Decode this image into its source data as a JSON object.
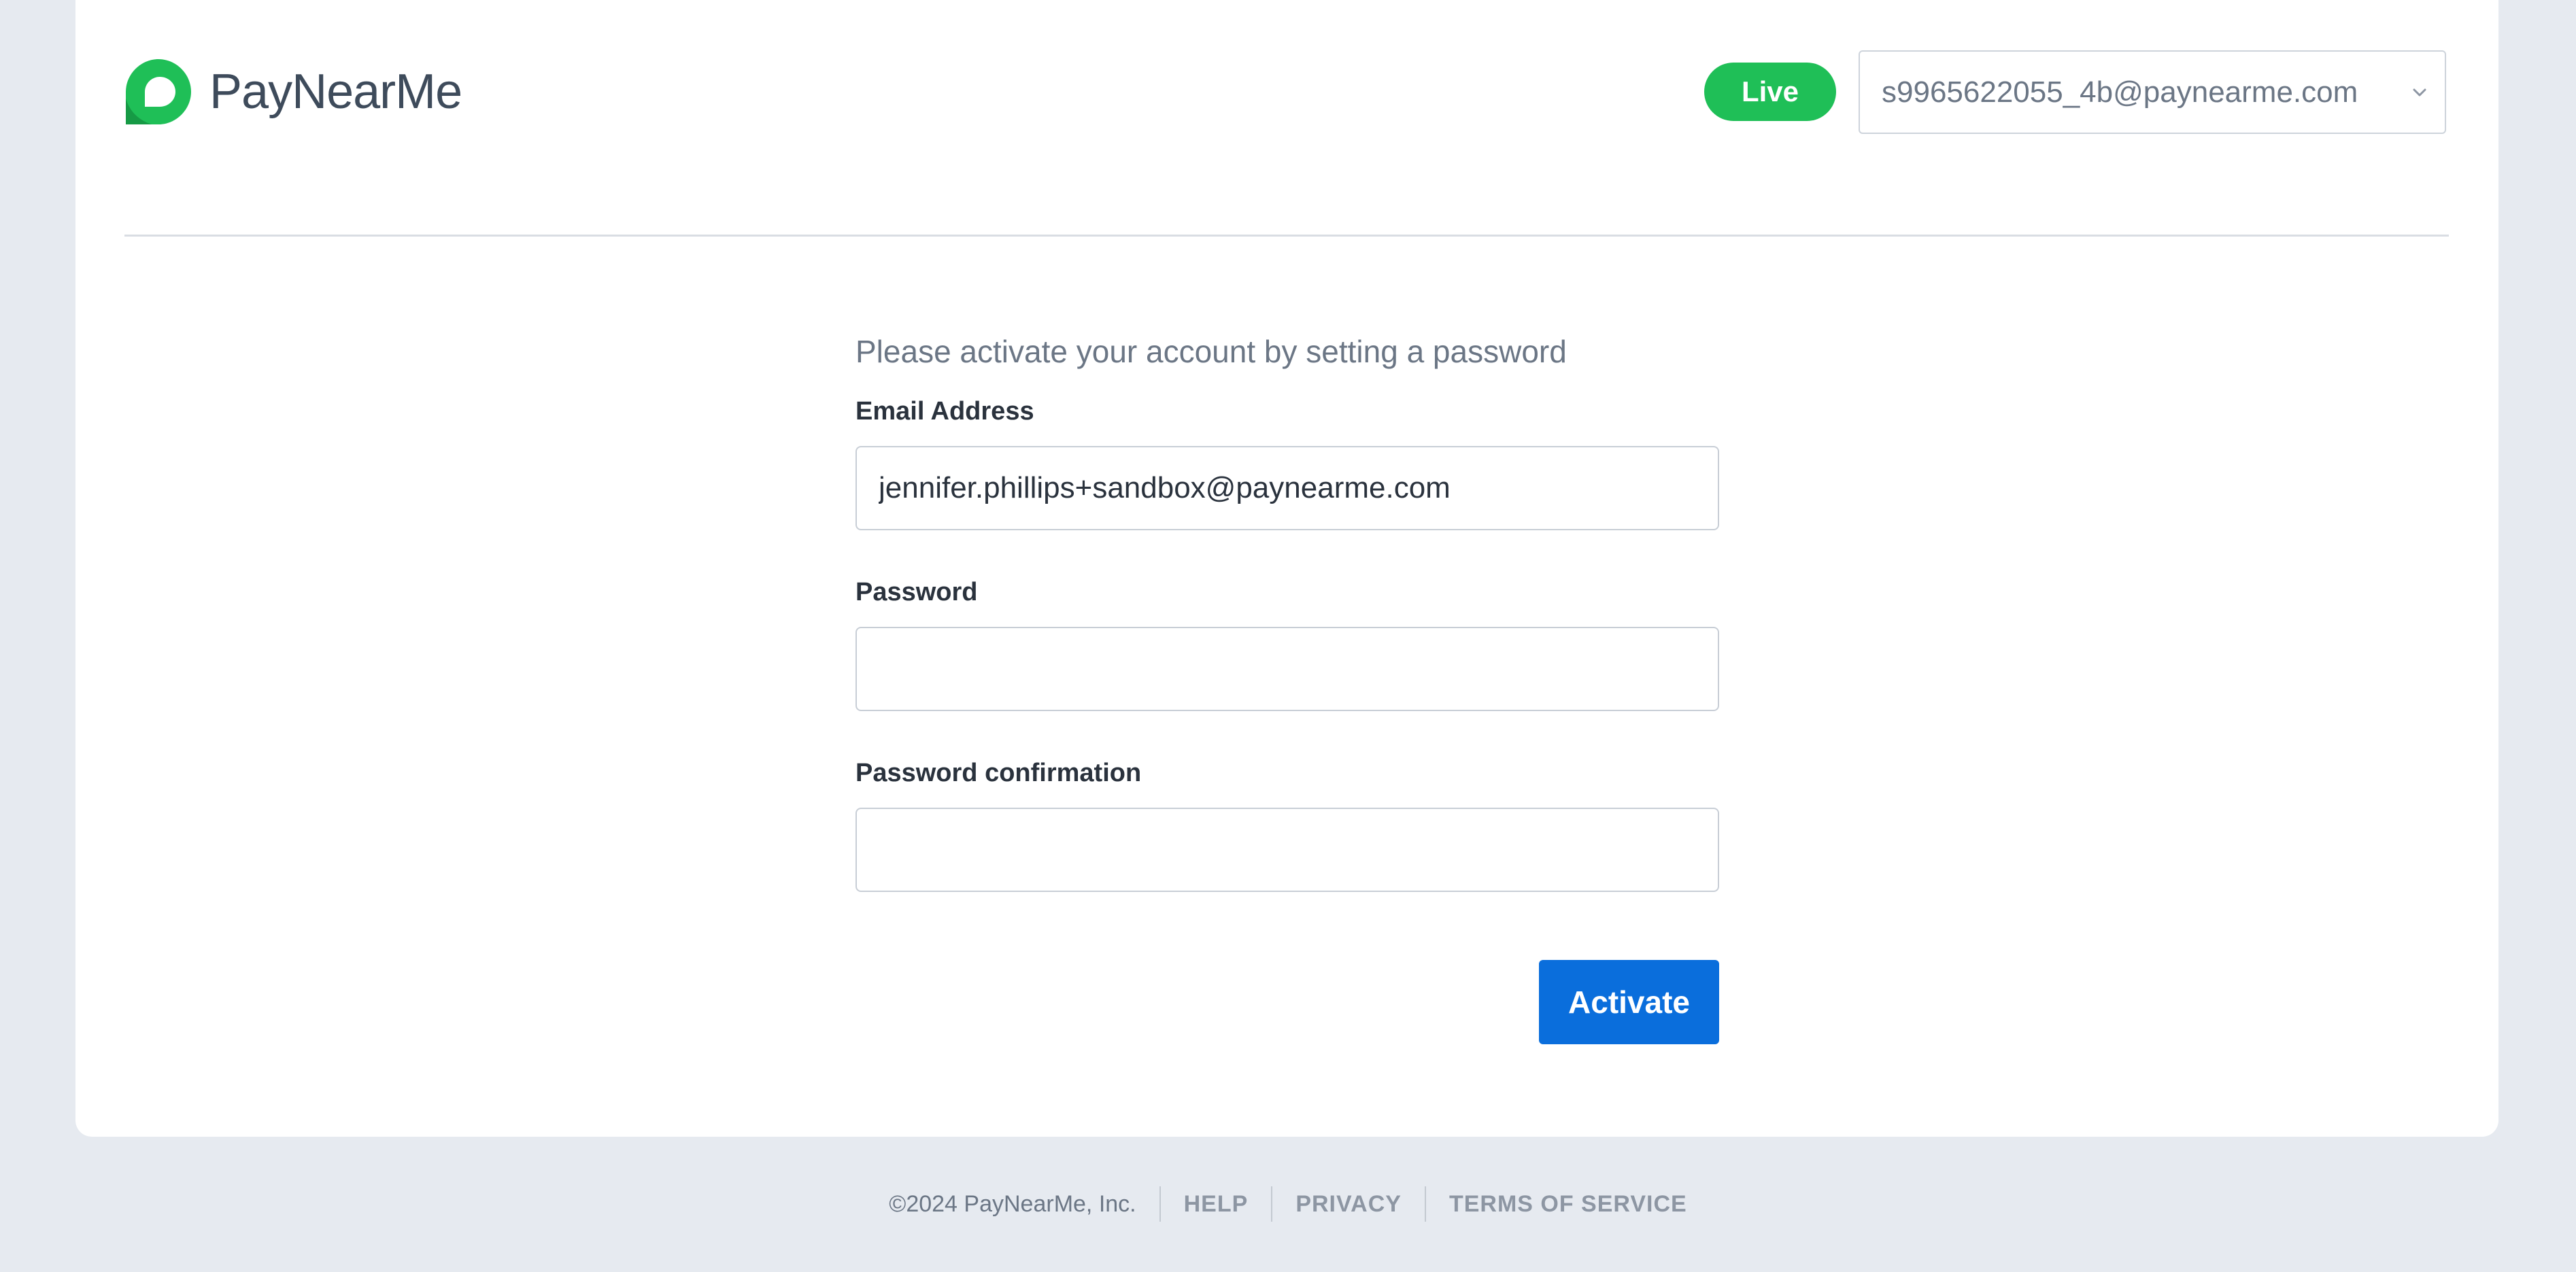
{
  "header": {
    "brand_name": "PayNearMe",
    "logo_icon": "paynearme-logo-icon",
    "environment_badge": "Live",
    "account_selector": {
      "selected_value": "s9965622055_4b@paynearme.com",
      "icon": "chevron-down-icon"
    }
  },
  "form": {
    "heading": "Please activate your account by setting a password",
    "email": {
      "label": "Email Address",
      "value": "jennifer.phillips+sandbox@paynearme.com",
      "placeholder": ""
    },
    "password": {
      "label": "Password",
      "value": "",
      "placeholder": ""
    },
    "password_confirmation": {
      "label": "Password confirmation",
      "value": "",
      "placeholder": ""
    },
    "submit_label": "Activate"
  },
  "footer": {
    "copyright": "©2024 PayNearMe, Inc.",
    "links": [
      "HELP",
      "PRIVACY",
      "TERMS OF SERVICE"
    ]
  },
  "colors": {
    "page_background": "#e6eaf0",
    "card_background": "#ffffff",
    "brand_green": "#1fbf57",
    "primary_blue": "#0a6edc",
    "text_dark": "#2a323d",
    "text_muted": "#6b7685"
  }
}
